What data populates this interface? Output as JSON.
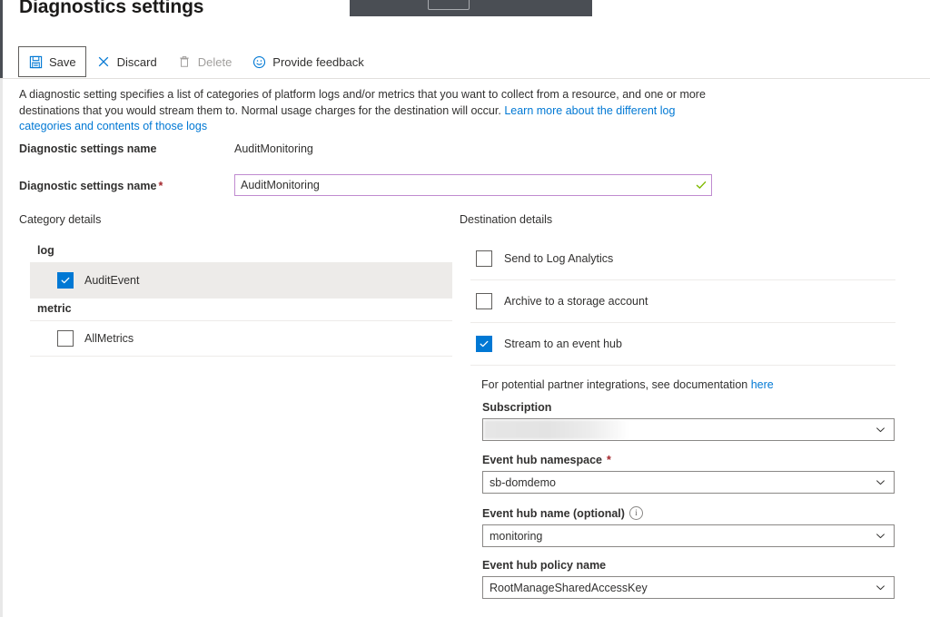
{
  "page": {
    "title": "Diagnostics settings"
  },
  "toolbar": {
    "items": [
      {
        "label": "Save",
        "icon": "save-icon",
        "disabled": false,
        "focused": true
      },
      {
        "label": "Discard",
        "icon": "close-x-icon",
        "disabled": false,
        "focused": false
      },
      {
        "label": "Delete",
        "icon": "trash-icon",
        "disabled": true,
        "focused": false
      },
      {
        "label": "Provide feedback",
        "icon": "smiley-icon",
        "disabled": false,
        "focused": false
      }
    ]
  },
  "description": {
    "text_part_1": "A diagnostic setting specifies a list of categories of platform logs and/or metrics that you want to collect from a resource, and one or more destinations that you would stream them to. Normal usage charges for the destination will occur. ",
    "link_text": "Learn more about the different log categories and contents of those logs"
  },
  "readonly_name": {
    "label": "Diagnostic settings name",
    "value": "AuditMonitoring"
  },
  "name_field": {
    "label": "Diagnostic settings name",
    "required_marker": "*",
    "value": "AuditMonitoring",
    "placeholder": "",
    "validation_icon": "green-check-icon"
  },
  "category_details": {
    "header": "Category details",
    "groups": [
      {
        "name": "log",
        "rows": [
          {
            "label": "AuditEvent",
            "checked": true,
            "highlighted": true
          }
        ]
      },
      {
        "name": "metric",
        "rows": [
          {
            "label": "AllMetrics",
            "checked": false,
            "highlighted": false
          }
        ]
      }
    ]
  },
  "destination_details": {
    "header": "Destination details",
    "options": [
      {
        "label": "Send to Log Analytics",
        "checked": false
      },
      {
        "label": "Archive to a storage account",
        "checked": false
      },
      {
        "label": "Stream to an event hub",
        "checked": true
      }
    ],
    "note_text": "For potential partner integrations, see documentation ",
    "note_link": "here",
    "fields": [
      {
        "label": "Subscription",
        "required": false,
        "info": false,
        "value": "",
        "redacted": true,
        "chevron": "chevron-down-icon"
      },
      {
        "label": "Event hub namespace",
        "required": true,
        "required_marker": "*",
        "info": false,
        "value": "sb-domdemo",
        "redacted": false,
        "chevron": "chevron-down-icon"
      },
      {
        "label": "Event hub name (optional)",
        "required": false,
        "info": true,
        "info_icon": "info-circle-icon",
        "value": "monitoring",
        "redacted": false,
        "chevron": "chevron-down-icon"
      },
      {
        "label": "Event hub policy name",
        "required": false,
        "info": false,
        "value": "RootManageSharedAccessKey",
        "redacted": false,
        "chevron": "chevron-down-icon"
      }
    ]
  },
  "colors": {
    "accent": "#0078d4",
    "link": "#0078d4",
    "required": "#a4262c",
    "input_focus_border": "#c08bd0",
    "valid_check": "#7fba00",
    "row_highlight": "#edebe9",
    "chrome_dark": "#4a4e54"
  }
}
